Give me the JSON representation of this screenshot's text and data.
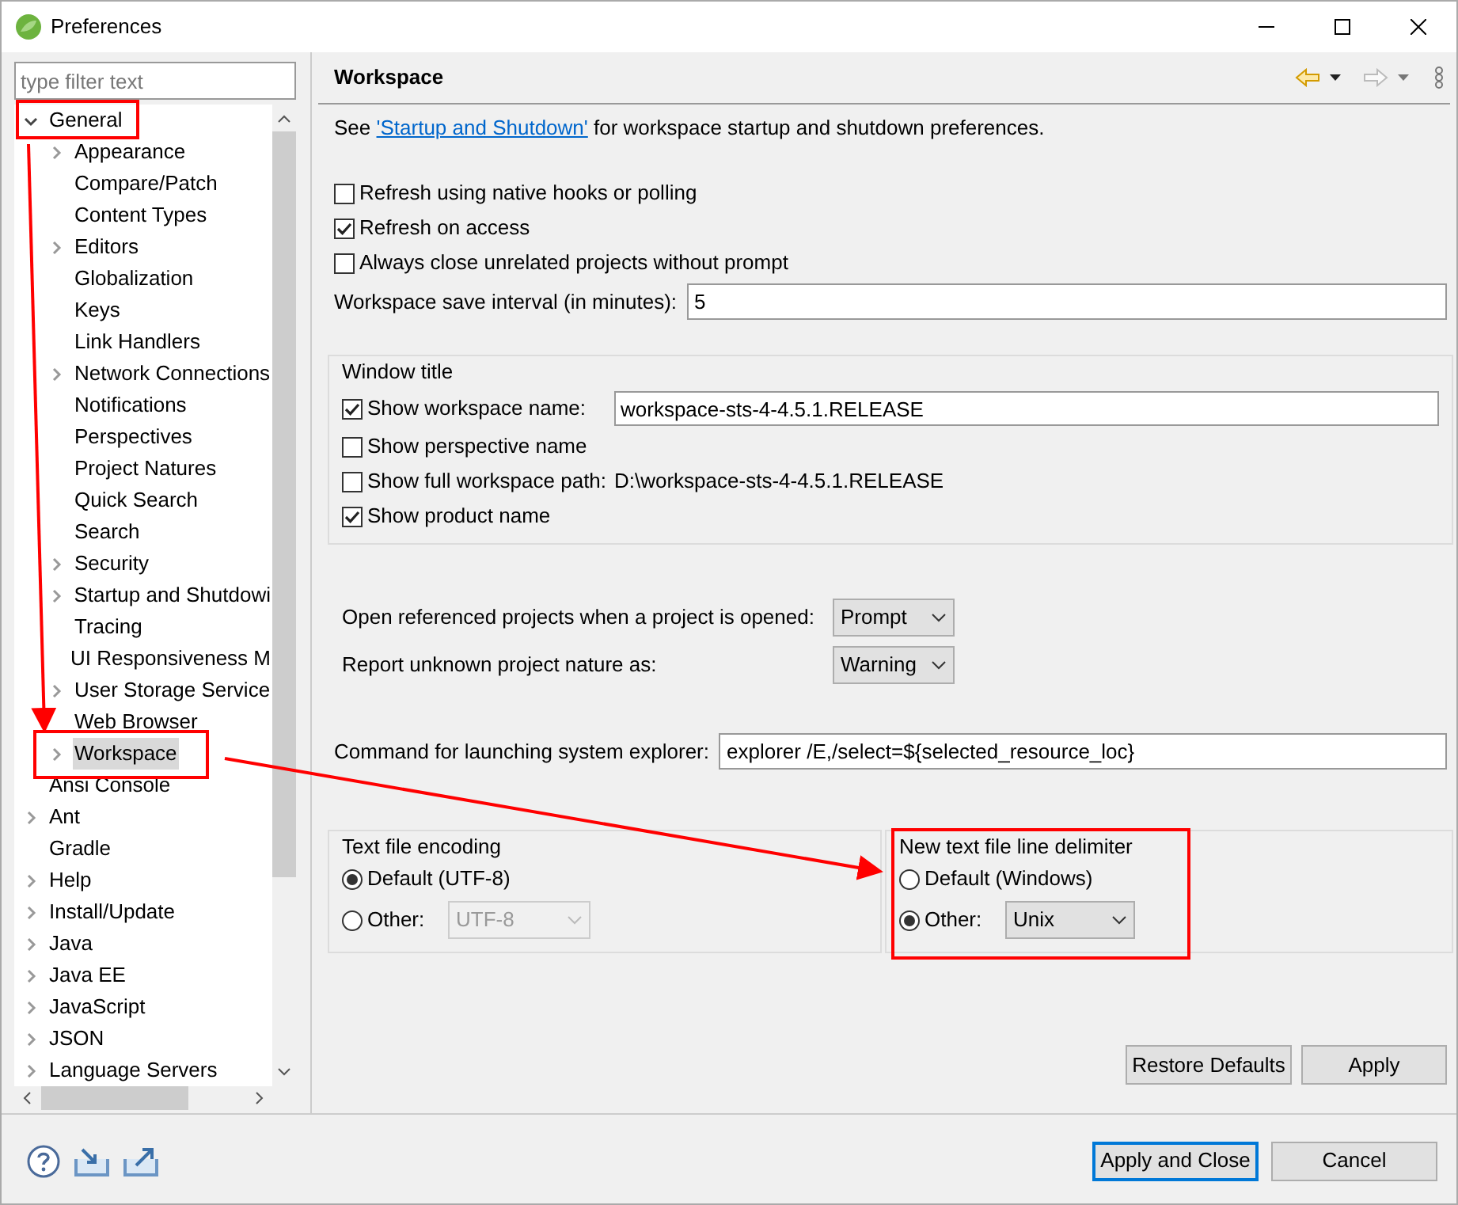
{
  "window": {
    "title": "Preferences"
  },
  "sidebar": {
    "filter": {
      "placeholder": "type filter text"
    },
    "tree": [
      {
        "label": "General",
        "expanded": true,
        "selected": false,
        "children": [
          {
            "label": "Appearance",
            "expanded": false,
            "selected": false
          },
          {
            "label": "Compare/Patch",
            "selected": false
          },
          {
            "label": "Content Types",
            "selected": false
          },
          {
            "label": "Editors",
            "expanded": false,
            "selected": false
          },
          {
            "label": "Globalization",
            "selected": false
          },
          {
            "label": "Keys",
            "selected": false
          },
          {
            "label": "Link Handlers",
            "selected": false
          },
          {
            "label": "Network Connections",
            "expanded": false,
            "selected": false
          },
          {
            "label": "Notifications",
            "selected": false
          },
          {
            "label": "Perspectives",
            "selected": false
          },
          {
            "label": "Project Natures",
            "selected": false
          },
          {
            "label": "Quick Search",
            "selected": false
          },
          {
            "label": "Search",
            "selected": false
          },
          {
            "label": "Security",
            "expanded": false,
            "selected": false
          },
          {
            "label": "Startup and Shutdowi",
            "expanded": false,
            "selected": false
          },
          {
            "label": "Tracing",
            "selected": false
          },
          {
            "label": "UI Responsiveness M",
            "selected": false
          },
          {
            "label": "User Storage Service",
            "expanded": false,
            "selected": false
          },
          {
            "label": "Web Browser",
            "selected": false
          },
          {
            "label": "Workspace",
            "expanded": false,
            "selected": true
          }
        ]
      },
      {
        "label": "Ansi Console",
        "selected": false
      },
      {
        "label": "Ant",
        "expanded": false,
        "selected": false
      },
      {
        "label": "Gradle",
        "selected": false
      },
      {
        "label": "Help",
        "expanded": false,
        "selected": false
      },
      {
        "label": "Install/Update",
        "expanded": false,
        "selected": false
      },
      {
        "label": "Java",
        "expanded": false,
        "selected": false
      },
      {
        "label": "Java EE",
        "expanded": false,
        "selected": false
      },
      {
        "label": "JavaScript",
        "expanded": false,
        "selected": false
      },
      {
        "label": "JSON",
        "expanded": false,
        "selected": false
      },
      {
        "label": "Language Servers",
        "expanded": false,
        "selected": false
      }
    ]
  },
  "page": {
    "title": "Workspace",
    "intro": {
      "before": "See",
      "link": "'Startup and Shutdown'",
      "after": "for workspace startup and shutdown preferences."
    },
    "checkboxes": [
      {
        "label": "Refresh using native hooks or polling",
        "checked": false
      },
      {
        "label": "Refresh on access",
        "checked": true
      },
      {
        "label": "Always close unrelated projects without prompt",
        "checked": false
      }
    ],
    "save_interval": {
      "label": "Workspace save interval (in minutes):",
      "value": "5"
    },
    "window_title": {
      "title": "Window title",
      "options": [
        {
          "kind": "field",
          "label": "Show workspace name:",
          "checked": true,
          "value": "workspace-sts-4-4.5.1.RELEASE"
        },
        {
          "kind": "plain",
          "label": "Show perspective name",
          "checked": false
        },
        {
          "kind": "text",
          "label": "Show full workspace path:",
          "checked": false,
          "value": "D:\\workspace-sts-4-4.5.1.RELEASE"
        },
        {
          "kind": "plain",
          "label": "Show product name",
          "checked": true
        }
      ]
    },
    "combos": [
      {
        "label": "Open referenced projects when a project is opened:",
        "value": "Prompt"
      },
      {
        "label": "Report unknown project nature as:",
        "value": "Warning"
      }
    ],
    "command": {
      "label": "Command for launching system explorer:",
      "value": "explorer /E,/select=${selected_resource_loc}"
    },
    "groups": [
      {
        "title": "Text file encoding",
        "options": [
          {
            "label": "Default (UTF-8)",
            "selected": true
          },
          {
            "label": "Other:",
            "selected": false,
            "combo": {
              "value": "UTF-8",
              "disabled": true
            }
          }
        ]
      },
      {
        "title": "New text file line delimiter",
        "options": [
          {
            "label": "Default (Windows)",
            "selected": false
          },
          {
            "label": "Other:",
            "selected": true,
            "combo": {
              "value": "Unix",
              "disabled": false
            }
          }
        ]
      }
    ],
    "buttons": [
      {
        "label": "Restore Defaults"
      },
      {
        "label": "Apply"
      }
    ]
  },
  "footer": {
    "buttons": [
      {
        "label": "Apply and Close",
        "default": true
      },
      {
        "label": "Cancel",
        "default": false
      }
    ]
  }
}
